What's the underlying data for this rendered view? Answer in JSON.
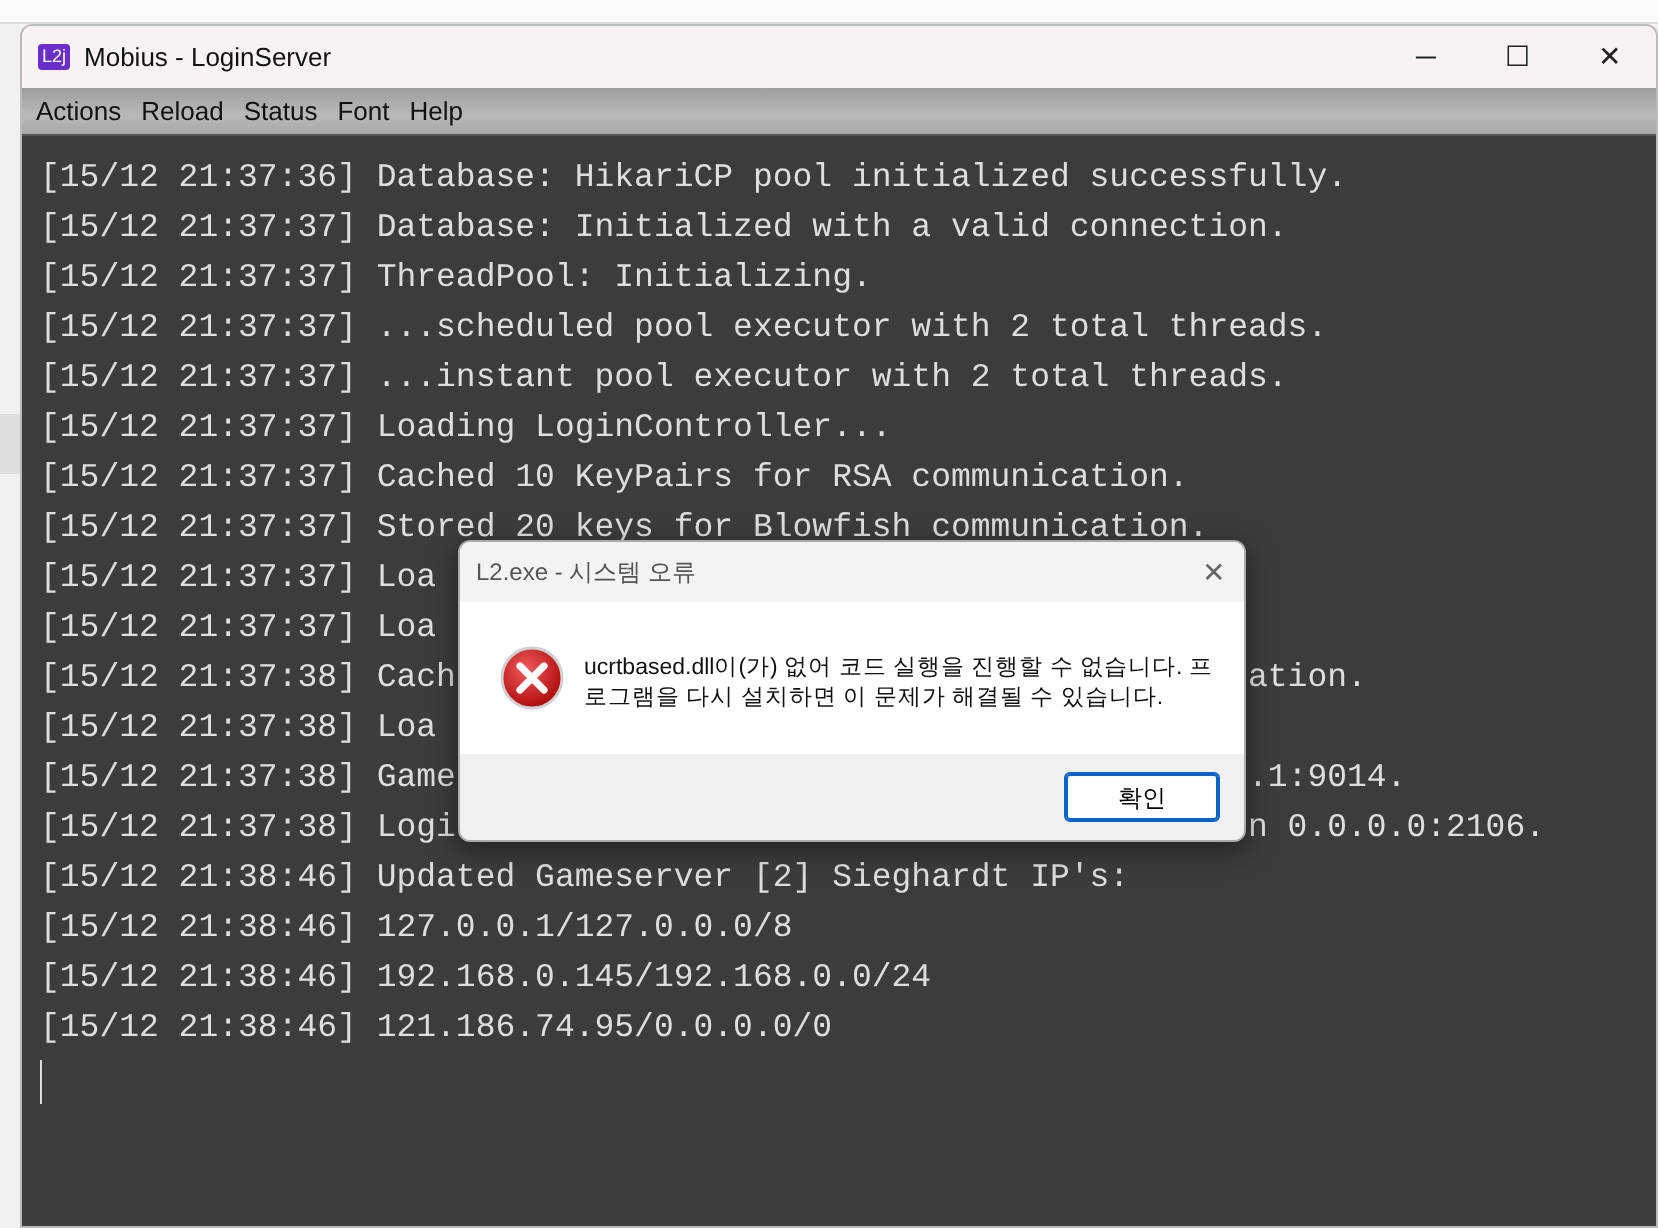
{
  "window": {
    "title": "Mobius - LoginServer",
    "app_badge": "L2j",
    "controls": [
      "─",
      "☐",
      "✕"
    ]
  },
  "menu": [
    "Actions",
    "Reload",
    "Status",
    "Font",
    "Help"
  ],
  "console": {
    "lines": [
      {
        "text": "[15/12 21:37:36] Database: HikariCP pool initialized successfully."
      },
      {
        "text": "[15/12 21:37:37] Database: Initialized with a valid connection."
      },
      {
        "text": "[15/12 21:37:37] ThreadPool: Initializing."
      },
      {
        "text": "[15/12 21:37:37] ...scheduled pool executor with 2 total threads."
      },
      {
        "text": "[15/12 21:37:37] ...instant pool executor with 2 total threads."
      },
      {
        "text": "[15/12 21:37:37] Loading LoginController..."
      },
      {
        "text": "[15/12 21:37:37] Cached 10 KeyPairs for RSA communication."
      },
      {
        "text": "[15/12 21:37:37] Stored 20 keys for Blowfish communication."
      },
      {
        "text": "[15/12 21:37:37] Loa"
      },
      {
        "text": "[15/12 21:37:37] Loa"
      },
      {
        "text": "[15/12 21:37:38] Cach",
        "tail": "ation."
      },
      {
        "text": "[15/12 21:37:38] Loa"
      },
      {
        "text": "[15/12 21:37:38] Game",
        "tail": ".1:9014."
      },
      {
        "text": "[15/12 21:37:38] Logi",
        "tail": "n 0.0.0.0:2106."
      },
      {
        "text": "[15/12 21:38:46] Updated Gameserver [2] Sieghardt IP's:"
      },
      {
        "text": "[15/12 21:38:46] 127.0.0.1/127.0.0.0/8"
      },
      {
        "text": "[15/12 21:38:46] 192.168.0.145/192.168.0.0/24"
      },
      {
        "text": "[15/12 21:38:46] 121.186.74.95/0.0.0.0/0"
      }
    ]
  },
  "dialog": {
    "title": "L2.exe - 시스템 오류",
    "close": "✕",
    "message": "ucrtbased.dll이(가) 없어 코드 실행을 진행할 수 없습니다. 프로그램을 다시 설치하면 이 문제가 해결될 수 있습니다.",
    "button": "확인"
  }
}
